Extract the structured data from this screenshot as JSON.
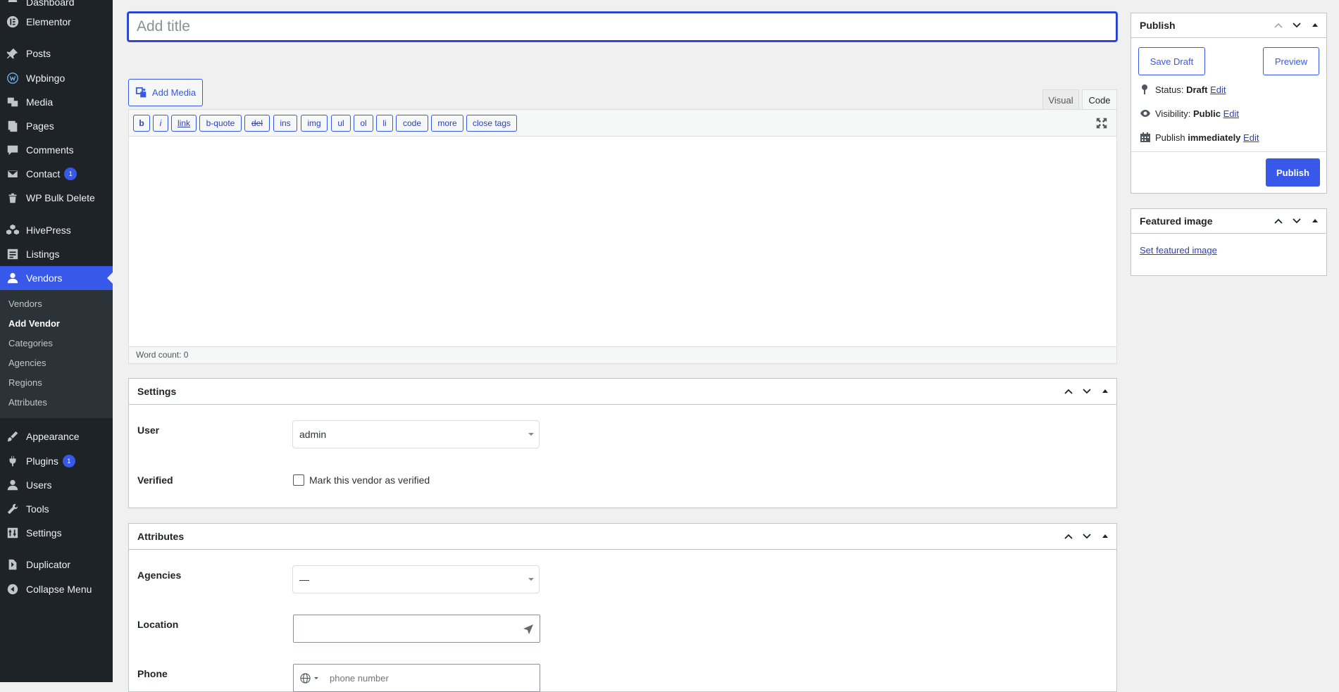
{
  "sidebar": {
    "top_partial_item": "Dashboard",
    "items": [
      {
        "label": "Elementor",
        "icon": "elementor-icon"
      },
      {
        "label": "Posts",
        "icon": "pin-icon"
      },
      {
        "label": "Wpbingo",
        "icon": "wpbingo-icon"
      },
      {
        "label": "Media",
        "icon": "media-icon"
      },
      {
        "label": "Pages",
        "icon": "pages-icon"
      },
      {
        "label": "Comments",
        "icon": "comment-icon"
      },
      {
        "label": "Contact",
        "icon": "mail-icon",
        "badge": "1"
      },
      {
        "label": "WP Bulk Delete",
        "icon": "trash-icon"
      },
      {
        "label": "HivePress",
        "icon": "hivepress-icon"
      },
      {
        "label": "Listings",
        "icon": "listings-icon"
      },
      {
        "label": "Vendors",
        "icon": "user-icon"
      },
      {
        "label": "Appearance",
        "icon": "brush-icon"
      },
      {
        "label": "Plugins",
        "icon": "plugin-icon",
        "badge": "1"
      },
      {
        "label": "Users",
        "icon": "user-icon"
      },
      {
        "label": "Tools",
        "icon": "wrench-icon"
      },
      {
        "label": "Settings",
        "icon": "settings-icon"
      },
      {
        "label": "Duplicator",
        "icon": "duplicator-icon"
      },
      {
        "label": "Collapse Menu",
        "icon": "collapse-icon"
      }
    ],
    "submenu": [
      "Vendors",
      "Add Vendor",
      "Categories",
      "Agencies",
      "Regions",
      "Attributes"
    ]
  },
  "editor": {
    "title_placeholder": "Add title",
    "add_media": "Add Media",
    "tab_visual": "Visual",
    "tab_code": "Code",
    "quicktags": [
      "b",
      "i",
      "link",
      "b-quote",
      "del",
      "ins",
      "img",
      "ul",
      "ol",
      "li",
      "code",
      "more",
      "close tags"
    ],
    "word_count": "Word count: 0"
  },
  "settings_box": {
    "title": "Settings",
    "user_label": "User",
    "user_value": "admin",
    "verified_label": "Verified",
    "verified_checkbox_label": "Mark this vendor as verified"
  },
  "attributes_box": {
    "title": "Attributes",
    "agencies_label": "Agencies",
    "agencies_value": "—",
    "location_label": "Location",
    "phone_label": "Phone",
    "phone_placeholder": "phone number"
  },
  "publish_box": {
    "title": "Publish",
    "save_draft": "Save Draft",
    "preview": "Preview",
    "status_label": "Status:",
    "status_value": "Draft",
    "visibility_label": "Visibility:",
    "visibility_value": "Public",
    "publish_label": "Publish",
    "publish_value": "immediately",
    "edit": "Edit",
    "publish_button": "Publish"
  },
  "featured_box": {
    "title": "Featured image",
    "link": "Set featured image"
  },
  "colors": {
    "accent": "#3858e9",
    "sidebar_bg": "#1d2327",
    "submenu_bg": "#2c3338"
  }
}
